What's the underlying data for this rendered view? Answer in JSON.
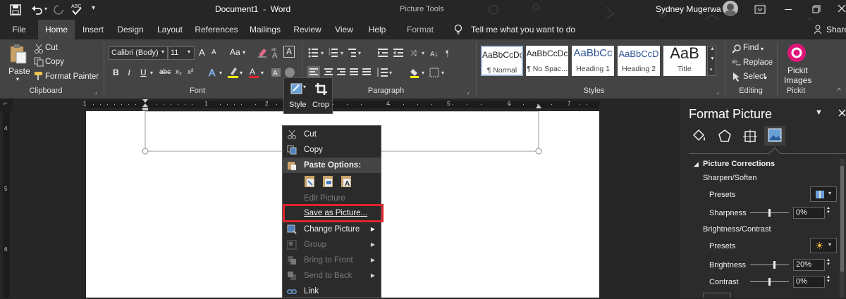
{
  "titlebar": {
    "document_title": "Document1  -  Word",
    "context_tools": "Picture Tools",
    "user_name": "Sydney Mugerwa"
  },
  "tabs": [
    {
      "label": "File"
    },
    {
      "label": "Home"
    },
    {
      "label": "Insert"
    },
    {
      "label": "Design"
    },
    {
      "label": "Layout"
    },
    {
      "label": "References"
    },
    {
      "label": "Mailings"
    },
    {
      "label": "Review"
    },
    {
      "label": "View"
    },
    {
      "label": "Help"
    },
    {
      "label": "Format"
    }
  ],
  "tell_me": "Tell me what you want to do",
  "share": "Share",
  "clipboard": {
    "paste": "Paste",
    "cut": "Cut",
    "copy": "Copy",
    "format_painter": "Format Painter",
    "group": "Clipboard"
  },
  "font": {
    "family": "Calibri (Body)",
    "size": "11",
    "group": "Font",
    "bold": "B",
    "italic": "I",
    "underline": "U",
    "strike": "abc",
    "sub": "x₂",
    "sup": "x²",
    "case": "Aa",
    "grow": "A",
    "shrink": "A"
  },
  "paragraph": {
    "group": "Paragraph"
  },
  "styles": {
    "group": "Styles",
    "items": [
      {
        "preview": "AaBbCcDc",
        "name": "¶ Normal"
      },
      {
        "preview": "AaBbCcDc",
        "name": "¶ No Spac..."
      },
      {
        "preview": "AaBbCc",
        "name": "Heading 1"
      },
      {
        "preview": "AaBbCcD",
        "name": "Heading 2"
      },
      {
        "preview": "AaB",
        "name": "Title"
      }
    ]
  },
  "editing": {
    "find": "Find",
    "replace": "Replace",
    "select": "Select",
    "group": "Editing"
  },
  "pickit": {
    "label1": "Pickit",
    "label2": "Images",
    "group": "Pickit"
  },
  "mini_toolbar": {
    "style": "Style",
    "crop": "Crop"
  },
  "ruler": {
    "marks": [
      "1",
      "1",
      "2",
      "3",
      "4",
      "5",
      "6",
      "7"
    ],
    "vmarks": [
      "4",
      "5",
      "6"
    ]
  },
  "context_menu": {
    "cut": "Cut",
    "copy": "Copy",
    "paste_options": "Paste Options:",
    "edit_picture": "Edit Picture",
    "save_as_picture": "Save as Picture...",
    "change_picture": "Change Picture",
    "group": "Group",
    "bring_to_front": "Bring to Front",
    "send_to_back": "Send to Back",
    "link": "Link"
  },
  "format_pane": {
    "title": "Format Picture",
    "section": "Picture Corrections",
    "sharpen_soften": "Sharpen/Soften",
    "presets": "Presets",
    "sharpness": "Sharpness",
    "sharpness_value": "0%",
    "brightness_contrast": "Brightness/Contrast",
    "presets2": "Presets",
    "brightness": "Brightness",
    "brightness_value": "20%",
    "contrast": "Contrast",
    "contrast_value": "0%"
  },
  "colors": {
    "highlight_box": "#e0242c",
    "pickit_brand": "#e0157a"
  }
}
